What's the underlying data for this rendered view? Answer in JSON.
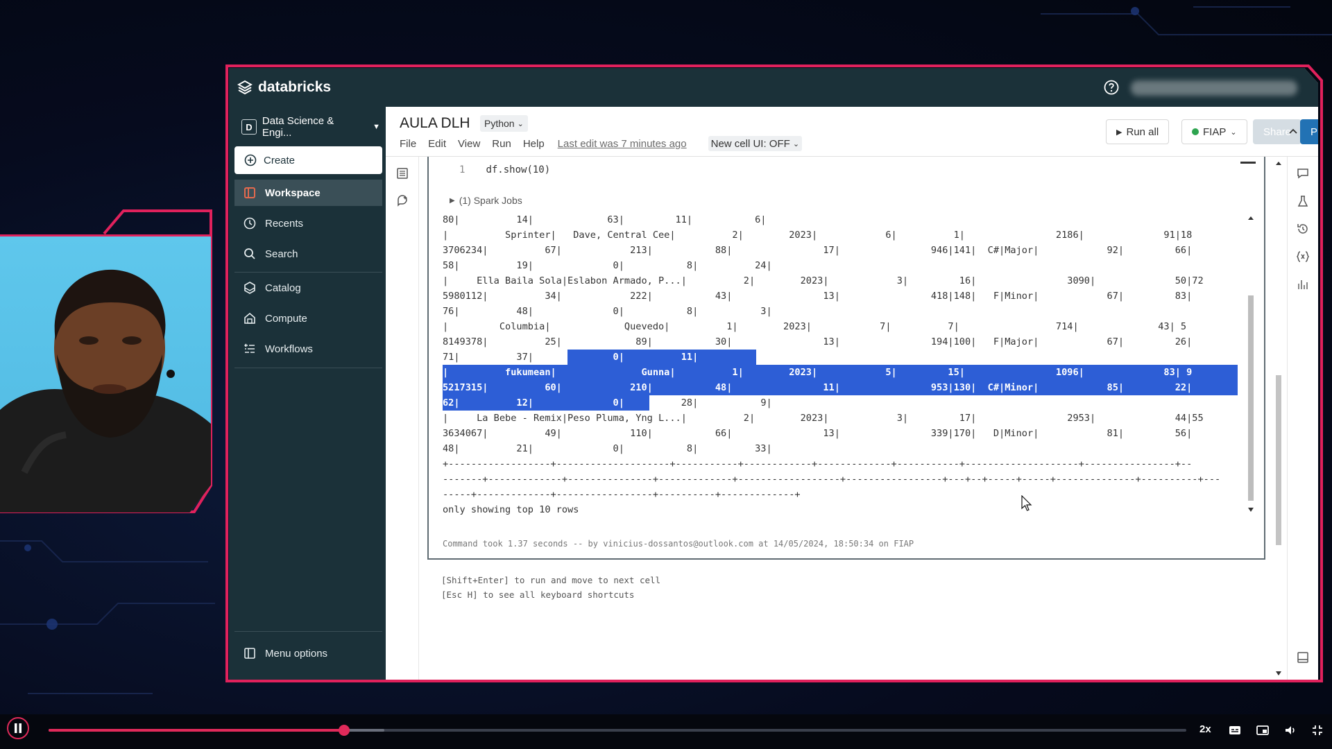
{
  "app": {
    "name": "databricks"
  },
  "sidebar": {
    "workspace_switcher": {
      "badge": "D",
      "label": "Data Science & Engi..."
    },
    "create_label": "Create",
    "items": [
      {
        "label": "Workspace",
        "icon": "workspace-icon",
        "active": true
      },
      {
        "label": "Recents",
        "icon": "clock-icon",
        "active": false
      },
      {
        "label": "Search",
        "icon": "search-icon",
        "active": false
      },
      {
        "label": "Catalog",
        "icon": "catalog-icon",
        "active": false
      },
      {
        "label": "Compute",
        "icon": "compute-icon",
        "active": false
      },
      {
        "label": "Workflows",
        "icon": "workflows-icon",
        "active": false
      }
    ],
    "menu_options": "Menu options"
  },
  "notebook": {
    "title": "AULA DLH",
    "language": "Python",
    "menus": [
      "File",
      "Edit",
      "View",
      "Run",
      "Help"
    ],
    "last_edit": "Last edit was 7 minutes ago",
    "new_cell_ui": "New cell UI: OFF",
    "run_all": "Run all",
    "cluster": "FIAP",
    "share": "Share",
    "publish": "Publish"
  },
  "cell": {
    "line_number": "1",
    "code": "df.show(10)",
    "spark_jobs": "(1) Spark Jobs",
    "output_lines": [
      "80|          14|             63|         11|           6|",
      "|          Sprinter|   Dave, Central Cee|          2|        2023|            6|          1|                2186|              91|18",
      "3706234|          67|            213|           88|                17|                946|141|  C#|Major|            92|         66|",
      "58|          19|              0|           8|          24|",
      "|     Ella Baila Sola|Eslabon Armado, P...|          2|        2023|            3|         16|                3090|              50|72",
      "5980112|          34|            222|           43|                13|                418|148|   F|Minor|            67|         83|",
      "76|          48|              0|           8|           3|",
      "|         Columbia|             Quevedo|          1|        2023|            7|          7|                 714|              43| 5",
      "8149378|          25|             89|           30|                13|                194|100|   F|Major|            67|         26|",
      "71|          37|              0|          11|           4|",
      "|          fukumean|               Gunna|          1|        2023|            5|         15|                1096|              83| 9",
      "5217315|          60|            210|           48|                11|                953|130|  C#|Minor|            85|         22|",
      "62|          12|              0|          28|           9|",
      "|     La Bebe - Remix|Peso Pluma, Yng L...|          2|        2023|            3|         17|                2953|              44|55",
      "3634067|          49|            110|           66|                13|                339|170|   D|Minor|            81|         56|",
      "48|          21|              0|           8|          33|",
      "+------------------+--------------------+-----------+------------+-------------+-----------+--------------------+----------------+--",
      "-------+-------------+---------------+-------------+------------------+-----------------+---+--+-----+-----+--------------+----------+---",
      "-----+-------------+-----------------+----------+-------------+",
      "only showing top 10 rows"
    ],
    "command_took": "Command took 1.37 seconds -- by vinicius-dossantos@outlook.com at 14/05/2024, 18:50:34 on FIAP"
  },
  "shortcuts": [
    "[Shift+Enter] to run and move to next cell",
    "[Esc H] to see all keyboard shortcuts"
  ],
  "player": {
    "speed": "2x",
    "progress": 0.26,
    "buffered": 0.295
  }
}
